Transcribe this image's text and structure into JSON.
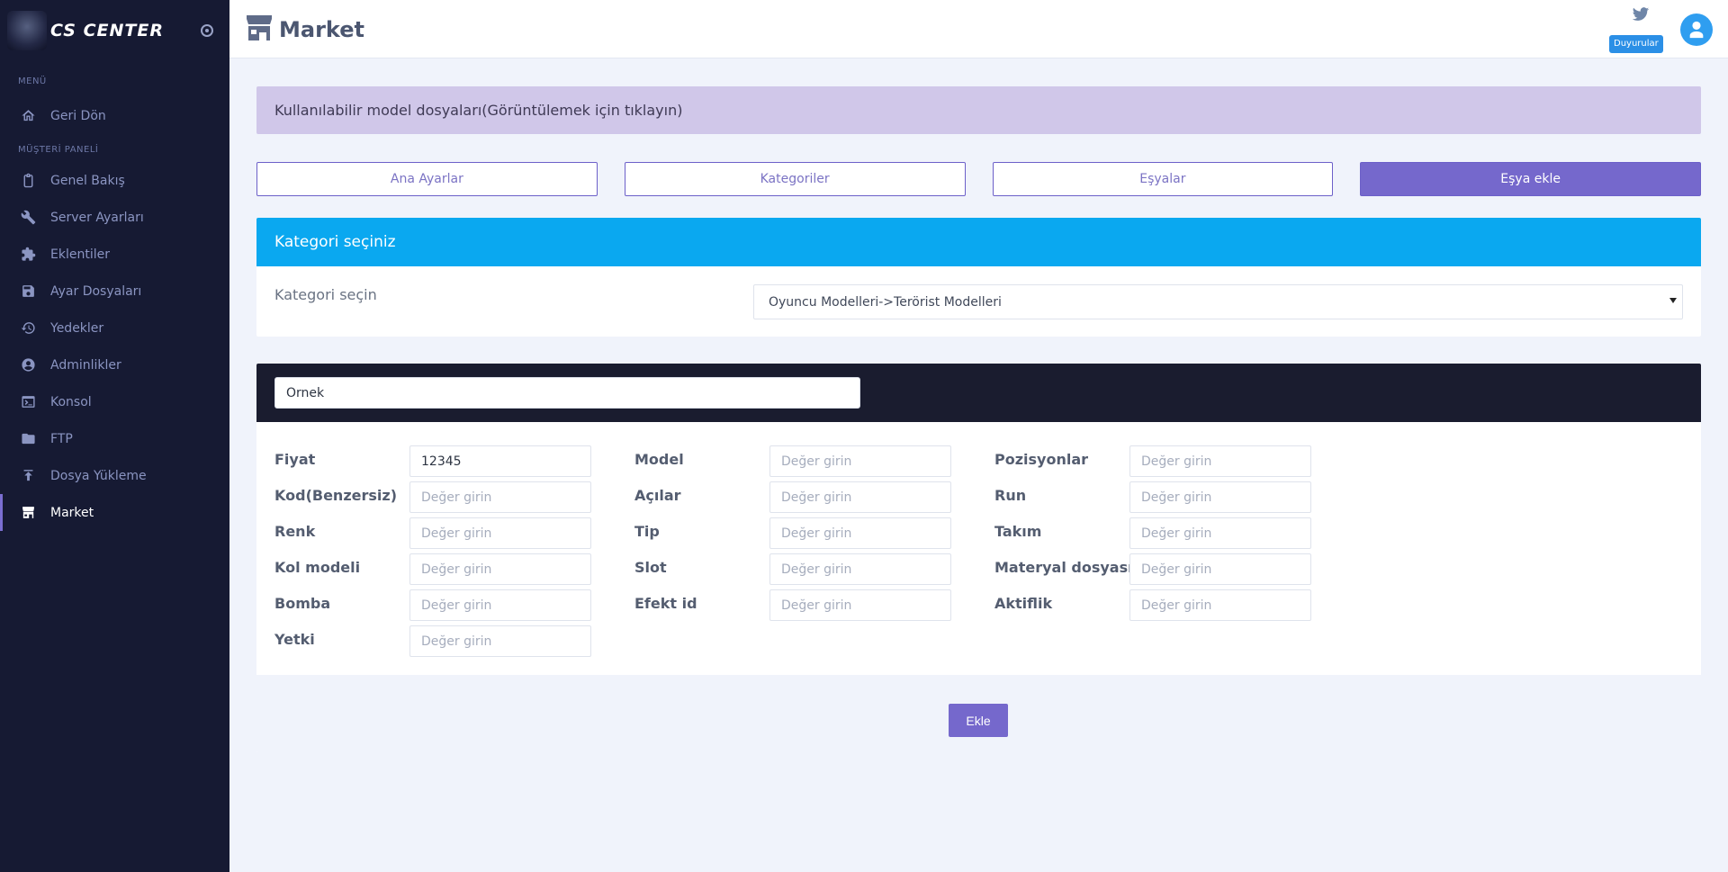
{
  "brand": {
    "name": "CS CENTER"
  },
  "sidebar": {
    "section_menu": "MENÜ",
    "section_panel": "MÜŞTERİ PANELİ",
    "back_label": "Geri Dön",
    "items": [
      {
        "label": "Genel Bakış",
        "icon": "clipboard-icon"
      },
      {
        "label": "Server Ayarları",
        "icon": "wrench-icon"
      },
      {
        "label": "Eklentiler",
        "icon": "puzzle-icon"
      },
      {
        "label": "Ayar Dosyaları",
        "icon": "save-icon"
      },
      {
        "label": "Yedekler",
        "icon": "history-icon"
      },
      {
        "label": "Adminlikler",
        "icon": "user-circle-icon"
      },
      {
        "label": "Konsol",
        "icon": "terminal-icon"
      },
      {
        "label": "FTP",
        "icon": "folder-icon"
      },
      {
        "label": "Dosya Yükleme",
        "icon": "upload-icon"
      },
      {
        "label": "Market",
        "icon": "store-icon",
        "active": true
      }
    ]
  },
  "header": {
    "title": "Market",
    "announcements_label": "Duyurular"
  },
  "info_bar": {
    "text": "Kullanılabilir model dosyaları(Görüntülemek için tıklayın)"
  },
  "tabs": [
    {
      "label": "Ana Ayarlar"
    },
    {
      "label": "Kategoriler"
    },
    {
      "label": "Eşyalar"
    },
    {
      "label": "Eşya ekle"
    }
  ],
  "category": {
    "header": "Kategori seçiniz",
    "label": "Kategori seçin",
    "selected": "Oyuncu Modelleri->Terörist Modelleri"
  },
  "item": {
    "name_value": "Örnek",
    "placeholder": "Değer girin",
    "fields": {
      "fiyat": {
        "label": "Fiyat",
        "value": "12345"
      },
      "kod": {
        "label": "Kod(Benzersiz)",
        "value": ""
      },
      "renk": {
        "label": "Renk",
        "value": ""
      },
      "kol_modeli": {
        "label": "Kol modeli",
        "value": ""
      },
      "bomba": {
        "label": "Bomba",
        "value": ""
      },
      "yetki": {
        "label": "Yetki",
        "value": ""
      },
      "model": {
        "label": "Model",
        "value": ""
      },
      "acilar": {
        "label": "Açılar",
        "value": ""
      },
      "tip": {
        "label": "Tip",
        "value": ""
      },
      "slot": {
        "label": "Slot",
        "value": ""
      },
      "efekt_id": {
        "label": "Efekt id",
        "value": ""
      },
      "pozisyonlar": {
        "label": "Pozisyonlar",
        "value": ""
      },
      "run": {
        "label": "Run",
        "value": ""
      },
      "takim": {
        "label": "Takım",
        "value": ""
      },
      "materyal": {
        "label": "Materyal dosyası",
        "value": ""
      },
      "aktiflik": {
        "label": "Aktiflik",
        "value": ""
      }
    },
    "submit_label": "Ekle"
  },
  "colors": {
    "sidebar_bg": "#161a33",
    "accent": "#7568cc",
    "category_header": "#0aa8f0",
    "item_header": "#1a1c2f",
    "info_bar": "#d0c7e9"
  }
}
